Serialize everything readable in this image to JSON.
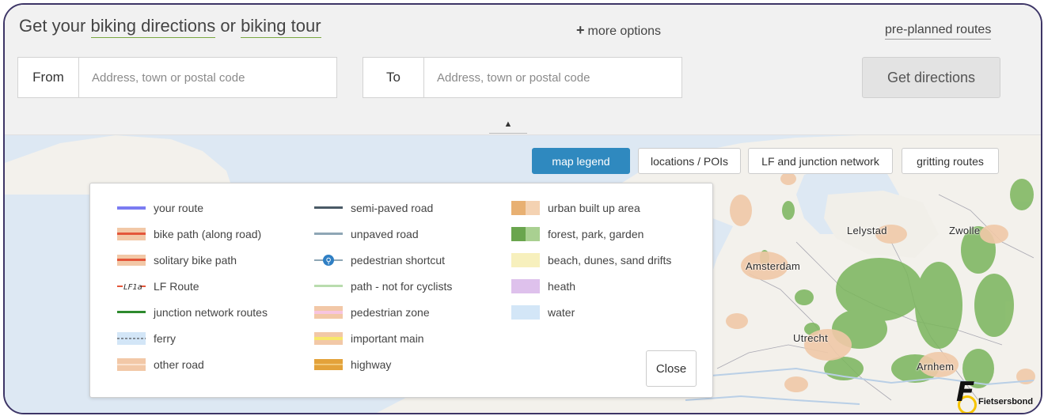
{
  "header": {
    "title_prefix": "Get your",
    "link_directions": "biking directions",
    "title_or": "or",
    "link_tour": "biking tour",
    "more_options": "more options",
    "more_options_icon": "plus-icon",
    "preplanned": "pre-planned routes"
  },
  "form": {
    "from_label": "From",
    "from_placeholder": "Address, town or postal code",
    "from_value": "",
    "to_label": "To",
    "to_placeholder": "Address, town or postal code",
    "to_value": "",
    "submit": "Get directions",
    "collapse_icon": "triangle-up-icon"
  },
  "tabs": [
    {
      "label": "map legend",
      "active": true
    },
    {
      "label": "locations / POIs",
      "active": false
    },
    {
      "label": "LF and junction network",
      "active": false
    },
    {
      "label": "gritting routes",
      "active": false
    }
  ],
  "legend": {
    "col1": [
      {
        "label": "your route",
        "swatch": "your-route"
      },
      {
        "label": "bike path (along road)",
        "swatch": "bike-path-along-road"
      },
      {
        "label": "solitary bike path",
        "swatch": "solitary-bike-path"
      },
      {
        "label": "LF Route",
        "swatch": "lf-route",
        "swatch_text": "LF1a"
      },
      {
        "label": "junction network routes",
        "swatch": "junction-network"
      },
      {
        "label": "ferry",
        "swatch": "ferry"
      },
      {
        "label": "other road",
        "swatch": "other-road"
      }
    ],
    "col2": [
      {
        "label": "semi-paved road",
        "swatch": "semi-paved"
      },
      {
        "label": "unpaved road",
        "swatch": "unpaved"
      },
      {
        "label": "pedestrian shortcut",
        "swatch": "pedestrian-shortcut"
      },
      {
        "label": "path - not for cyclists",
        "swatch": "path-no-cyclists"
      },
      {
        "label": "pedestrian zone",
        "swatch": "pedestrian-zone"
      },
      {
        "label": "important main",
        "swatch": "important-main"
      },
      {
        "label": "highway",
        "swatch": "highway"
      }
    ],
    "col3": [
      {
        "label": "urban built up area",
        "swatch": "urban"
      },
      {
        "label": "forest, park, garden",
        "swatch": "forest"
      },
      {
        "label": "beach, dunes, sand drifts",
        "swatch": "beach"
      },
      {
        "label": "heath",
        "swatch": "heath"
      },
      {
        "label": "water",
        "swatch": "water"
      }
    ],
    "close": "Close"
  },
  "map": {
    "cities": [
      "Lelystad",
      "Zwolle",
      "Amsterdam",
      "Utrecht",
      "Arnhem"
    ]
  },
  "logo": {
    "text": "Fietsersbond",
    "letter": "F"
  },
  "colors": {
    "accent": "#2f89bf",
    "link_underline": "#7aa83f",
    "frame": "#3d3566",
    "water": "#dde8f3",
    "land": "#f3f1ec",
    "forest": "#7ab55c",
    "urban": "#f0c9a8"
  }
}
